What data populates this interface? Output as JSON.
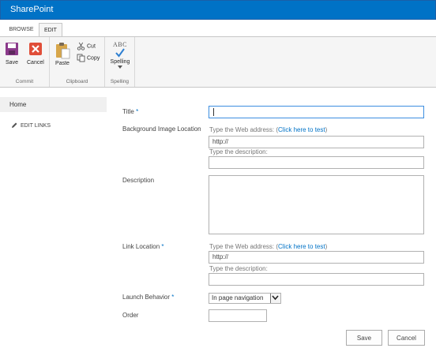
{
  "suite": {
    "brand": "SharePoint"
  },
  "tabs": {
    "browse": "BROWSE",
    "edit": "EDIT"
  },
  "ribbon": {
    "commit": {
      "save": "Save",
      "cancel": "Cancel",
      "group": "Commit"
    },
    "clipboard": {
      "paste": "Paste",
      "cut": "Cut",
      "copy": "Copy",
      "group": "Clipboard"
    },
    "spelling": {
      "button": "Spelling",
      "abc": "ABC",
      "group": "Spelling"
    }
  },
  "nav": {
    "home": "Home",
    "edit_links": "EDIT LINKS"
  },
  "form": {
    "title_label": "Title",
    "required_mark": "*",
    "bg_label": "Background Image Location",
    "web_address_text": "Type the Web address: (",
    "test_link": "Click here to test",
    "close_paren": ")",
    "url_value": "http://",
    "desc_hint": "Type the description:",
    "description_label": "Description",
    "link_label": "Link Location",
    "launch_label": "Launch Behavior",
    "launch_value": "In page navigation",
    "order_label": "Order"
  },
  "buttons": {
    "save": "Save",
    "cancel": "Cancel"
  },
  "colors": {
    "suite_bar": "#0072c6",
    "link": "#0072c6",
    "required": "#0072c6",
    "cancel_icon": "#e04e39",
    "save_icon": "#8b3a8b"
  }
}
